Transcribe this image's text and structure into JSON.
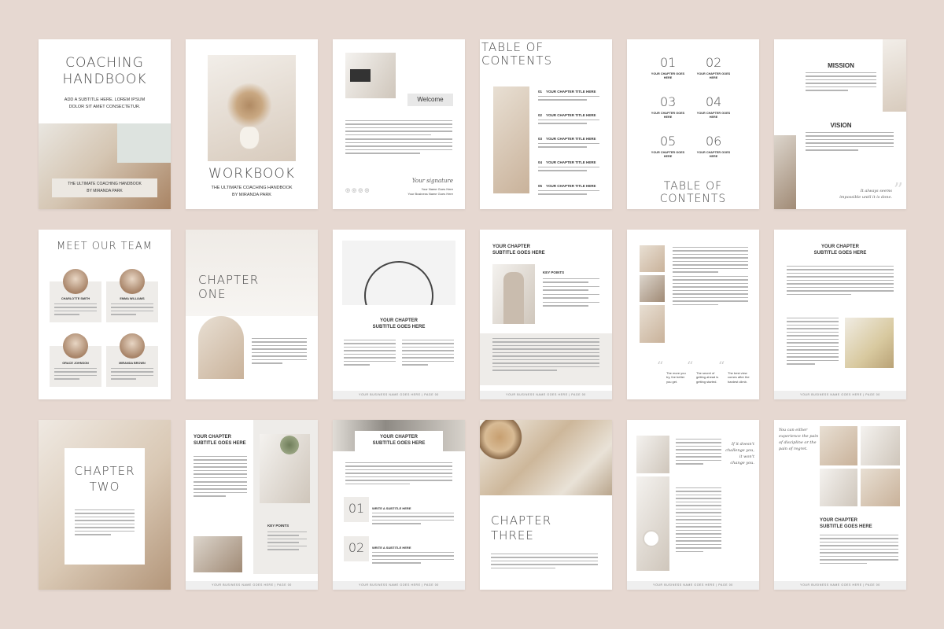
{
  "p1": {
    "title1": "COACHING",
    "title2": "HANDBOOK",
    "subtitle1": "ADD A SUBTITLE HERE. LOREM IPSUM",
    "subtitle2": "DOLOR SIT AMET CONSECTETUR.",
    "banner1": "THE ULTIMATE COACHING HANDBOOK",
    "banner2": "BY MIRANDA PARK"
  },
  "p2": {
    "title": "WORKBOOK",
    "sub1": "THE ULTIMATE COACHING HANDBOOK",
    "sub2": "BY MIRANDA PARK"
  },
  "p3": {
    "welcome": "Welcome",
    "signature": "Your signature",
    "name1": "Your Name Goes Here",
    "name2": "Your Business Name Goes Here"
  },
  "p4": {
    "title1": "TABLE OF",
    "title2": "CONTENTS",
    "items": [
      {
        "n": "01",
        "t": "YOUR CHAPTER TITLE HERE"
      },
      {
        "n": "02",
        "t": "YOUR CHAPTER TITLE HERE"
      },
      {
        "n": "03",
        "t": "YOUR CHAPTER TITLE HERE"
      },
      {
        "n": "04",
        "t": "YOUR CHAPTER TITLE HERE"
      },
      {
        "n": "05",
        "t": "YOUR CHAPTER TITLE HERE"
      }
    ]
  },
  "p5": {
    "nums": [
      "01",
      "02",
      "03",
      "04",
      "05",
      "06"
    ],
    "item": "YOUR CHAPTER GOES HERE",
    "title1": "TABLE OF",
    "title2": "CONTENTS"
  },
  "p6": {
    "mission": "MISSION",
    "vision": "VISION",
    "quote1": "It always seems",
    "quote2": "impossible until it is done."
  },
  "p7": {
    "title": "MEET OUR TEAM",
    "members": [
      "CHARLOTTE SMITH",
      "EMMA WILLIAMS",
      "GRACE JOHNSON",
      "MIRANDA BROWN"
    ]
  },
  "p8": {
    "title1": "CHAPTER",
    "title2": "ONE"
  },
  "p9": {
    "sub1": "YOUR CHAPTER",
    "sub2": "SUBTITLE GOES HERE"
  },
  "p10": {
    "sub1": "YOUR CHAPTER",
    "sub2": "SUBTITLE GOES HERE",
    "kp": "KEY POINTS"
  },
  "p11": {
    "q1": "The more you try, the better you get.",
    "q2": "The secret of getting ahead is getting started.",
    "q3": "The best view comes after the hardest climb."
  },
  "p12": {
    "sub1": "YOUR CHAPTER",
    "sub2": "SUBTITLE GOES HERE"
  },
  "p13": {
    "title1": "CHAPTER",
    "title2": "TWO"
  },
  "p14": {
    "sub1": "YOUR CHAPTER",
    "sub2": "SUBTITLE GOES HERE",
    "kp": "KEY POINTS"
  },
  "p15": {
    "sub1": "YOUR CHAPTER",
    "sub2": "SUBTITLE GOES HERE",
    "n1": "01",
    "n2": "02",
    "w1": "WRITE A SUBTITLE HERE",
    "w2": "WRITE A SUBTITLE HERE"
  },
  "p16": {
    "title1": "CHAPTER",
    "title2": "THREE"
  },
  "p17": {
    "q1": "If it doesn't",
    "q2": "challenge you,",
    "q3": "it won't",
    "q4": "change you."
  },
  "p18": {
    "q1": "You can either",
    "q2": "experience the pain",
    "q3": "of discipline or the",
    "q4": "pain of regret.",
    "sub1": "YOUR CHAPTER",
    "sub2": "SUBTITLE GOES HERE"
  },
  "footer": "YOUR BUSINESS NAME GOES HERE  |  PAGE 00"
}
